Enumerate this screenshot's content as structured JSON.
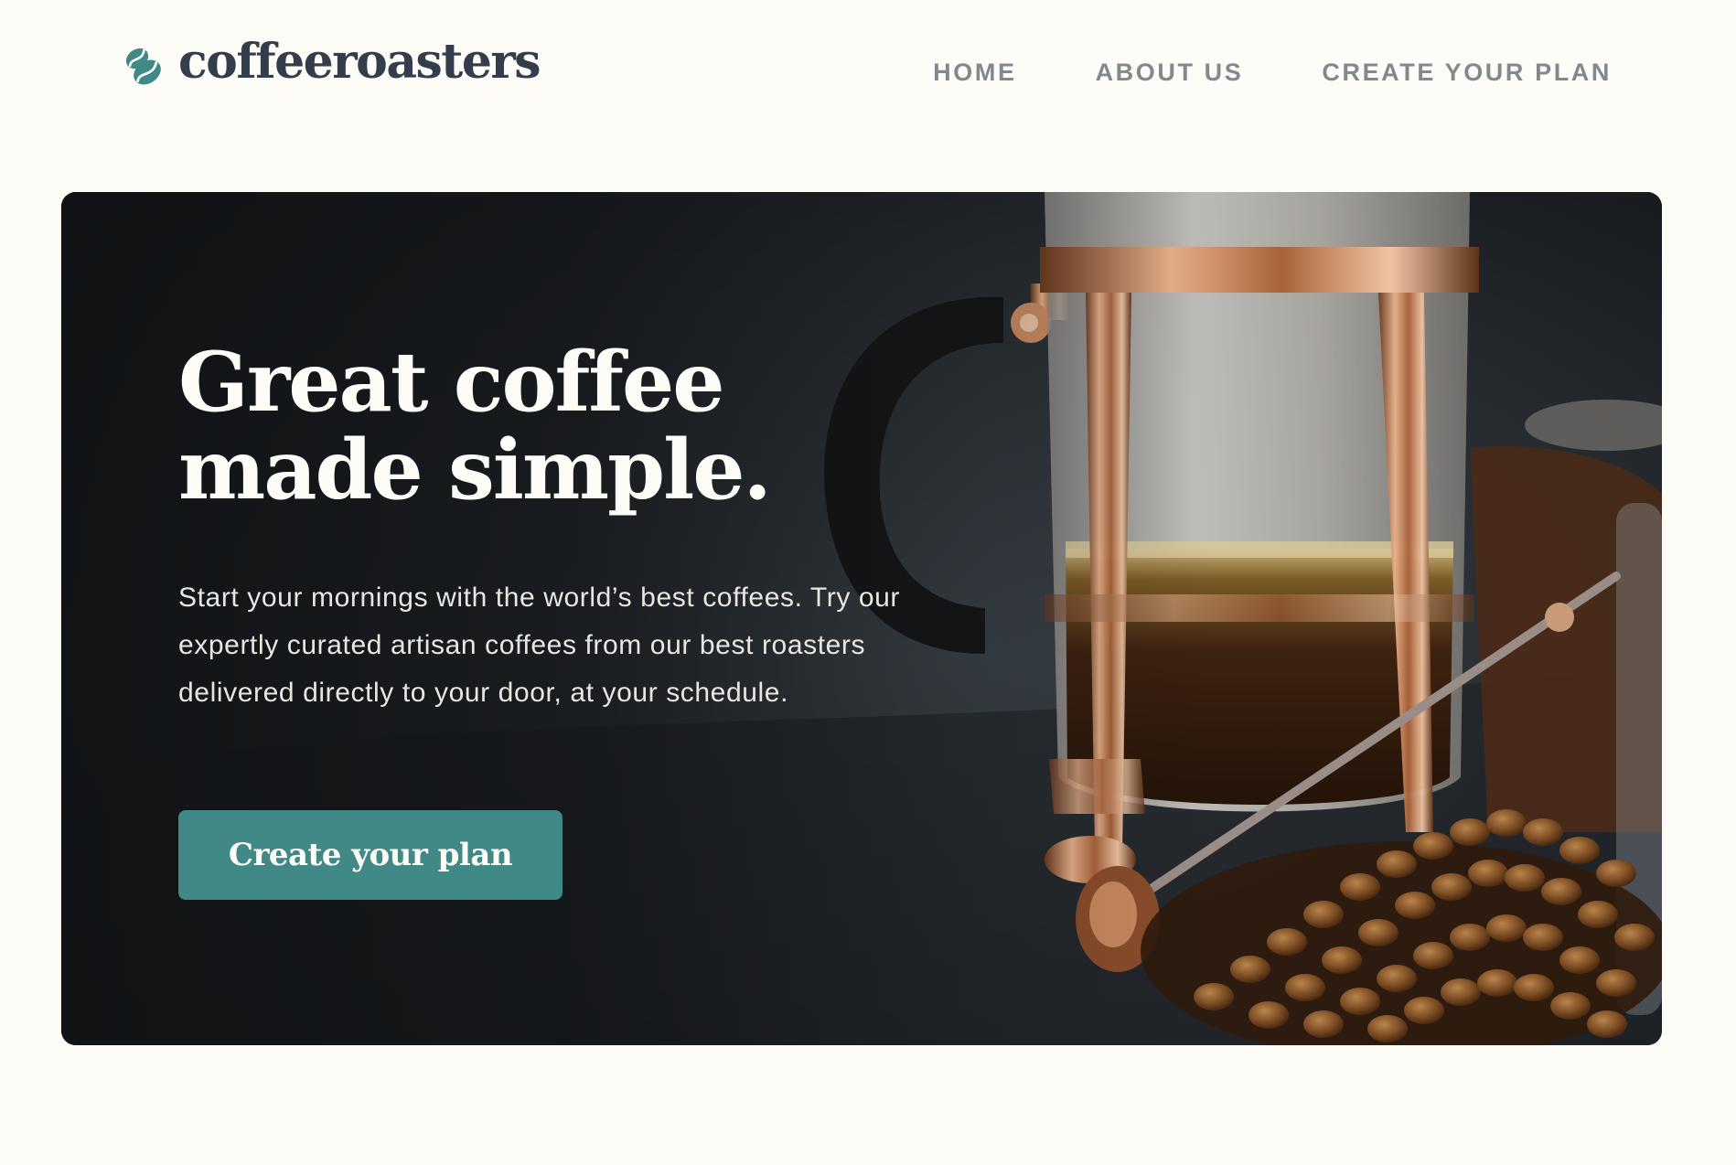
{
  "brand": {
    "name": "coffeeroasters",
    "logo_icon": "coffee-bean-icon",
    "accent_color": "#408987",
    "text_color": "#333D4B",
    "background_color": "#FEFCF7"
  },
  "nav": {
    "items": [
      {
        "label": "HOME"
      },
      {
        "label": "ABOUT US"
      },
      {
        "label": "CREATE YOUR PLAN"
      }
    ]
  },
  "hero": {
    "title": "Great coffee\nmade simple.",
    "description": "Start your mornings with the world’s best coffees. Try our expertly curated artisan coffees from our best roasters delivered directly to your door, at your schedule.",
    "cta_label": "Create your plan",
    "image_subject": "french-press-with-coffee-beans-photo"
  }
}
